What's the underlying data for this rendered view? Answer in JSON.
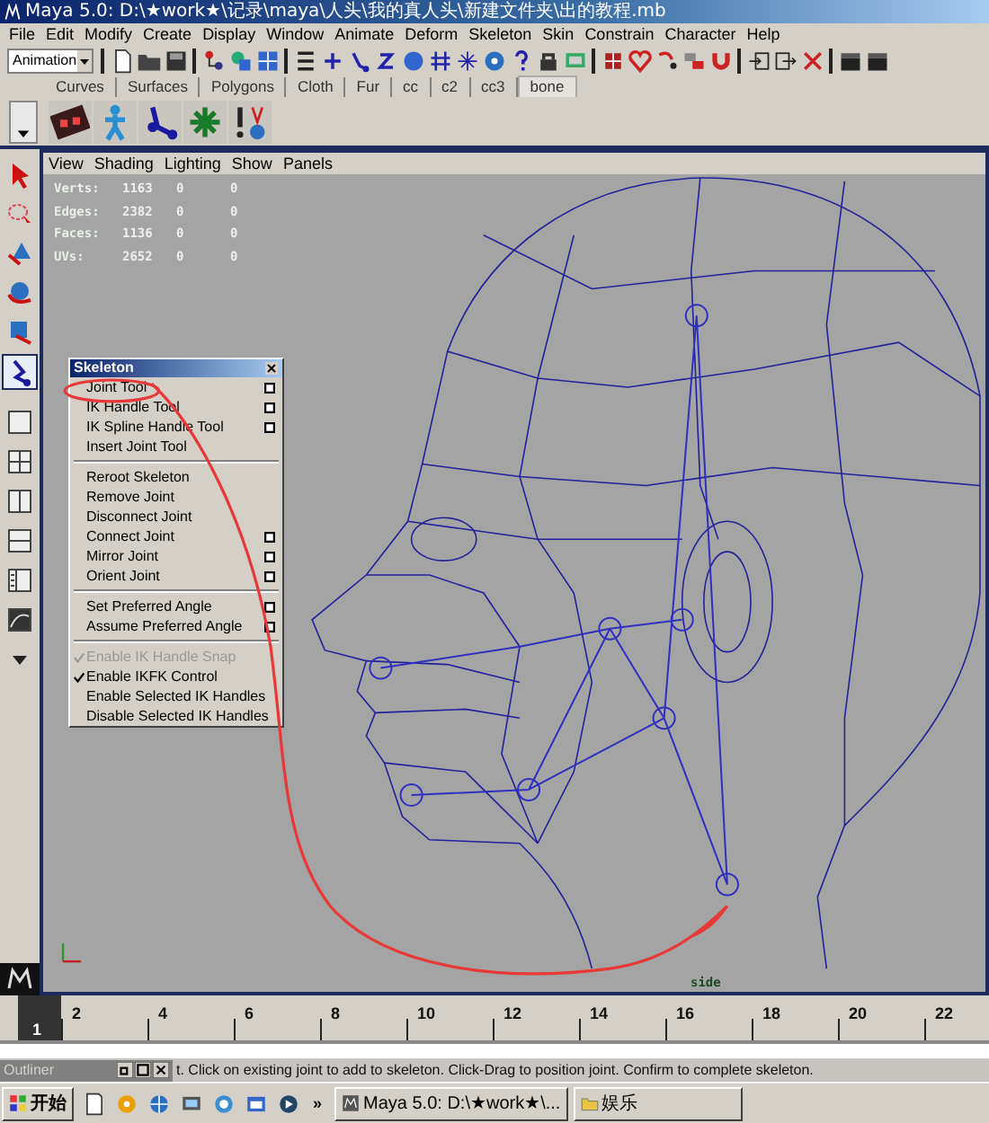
{
  "window": {
    "title": "Maya 5.0: D:\\★work★\\记录\\maya\\人头\\我的真人头\\新建文件夹\\出的教程.mb"
  },
  "menu_bar": [
    "File",
    "Edit",
    "Modify",
    "Create",
    "Display",
    "Window",
    "Animate",
    "Deform",
    "Skeleton",
    "Skin",
    "Constrain",
    "Character",
    "Help"
  ],
  "status_line": {
    "menu_set": "Animation"
  },
  "shelf": {
    "tabs": [
      {
        "label": "Curves",
        "selected": false
      },
      {
        "label": "Surfaces",
        "selected": false
      },
      {
        "label": "Polygons",
        "selected": false
      },
      {
        "label": "Cloth",
        "selected": false
      },
      {
        "label": "Fur",
        "selected": false
      },
      {
        "label": "cc",
        "selected": false
      },
      {
        "label": "c2",
        "selected": false
      },
      {
        "label": "cc3",
        "selected": false
      },
      {
        "label": "bone",
        "selected": true
      }
    ]
  },
  "toolbox": {
    "tools": [
      {
        "kind": "select",
        "selected": false
      },
      {
        "kind": "lasso",
        "selected": false
      },
      {
        "kind": "move",
        "selected": false
      },
      {
        "kind": "rotate",
        "selected": false
      },
      {
        "kind": "scale",
        "selected": false
      },
      {
        "kind": "joint",
        "selected": true
      },
      {
        "kind": "layout-single",
        "selected": false
      },
      {
        "kind": "layout-four",
        "selected": false
      },
      {
        "kind": "layout-two",
        "selected": false
      },
      {
        "kind": "layout-stack",
        "selected": false
      },
      {
        "kind": "layout-outliner",
        "selected": false
      },
      {
        "kind": "layout-graph",
        "selected": false
      },
      {
        "kind": "layout-menu",
        "selected": false
      }
    ]
  },
  "viewport": {
    "menu": [
      "View",
      "Shading",
      "Lighting",
      "Show",
      "Panels"
    ],
    "stats": [
      {
        "label": "Verts:",
        "values": [
          "1163",
          "0",
          "0"
        ]
      },
      {
        "label": "Edges:",
        "values": [
          "2382",
          "0",
          "0"
        ]
      },
      {
        "label": "Faces:",
        "values": [
          "1136",
          "0",
          "0"
        ]
      },
      {
        "label": "UVs:",
        "values": [
          "2652",
          "0",
          "0"
        ]
      }
    ],
    "camera": "side"
  },
  "skeleton_menu": {
    "title": "Skeleton",
    "sections": [
      [
        {
          "label": "Joint Tool",
          "option_box": true,
          "checked": false,
          "disabled": false
        },
        {
          "label": "IK Handle Tool",
          "option_box": true,
          "checked": false,
          "disabled": false
        },
        {
          "label": "IK Spline Handle Tool",
          "option_box": true,
          "checked": false,
          "disabled": false
        },
        {
          "label": "Insert Joint Tool",
          "option_box": false,
          "checked": false,
          "disabled": false
        }
      ],
      [
        {
          "label": "Reroot Skeleton",
          "option_box": false,
          "checked": false,
          "disabled": false
        },
        {
          "label": "Remove Joint",
          "option_box": false,
          "checked": false,
          "disabled": false
        },
        {
          "label": "Disconnect Joint",
          "option_box": false,
          "checked": false,
          "disabled": false
        },
        {
          "label": "Connect Joint",
          "option_box": true,
          "checked": false,
          "disabled": false
        },
        {
          "label": "Mirror Joint",
          "option_box": true,
          "checked": false,
          "disabled": false
        },
        {
          "label": "Orient Joint",
          "option_box": true,
          "checked": false,
          "disabled": false
        }
      ],
      [
        {
          "label": "Set Preferred Angle",
          "option_box": true,
          "checked": false,
          "disabled": false
        },
        {
          "label": "Assume Preferred Angle",
          "option_box": true,
          "checked": false,
          "disabled": false
        }
      ],
      [
        {
          "label": "Enable IK Handle Snap",
          "option_box": false,
          "checked": true,
          "disabled": true
        },
        {
          "label": "Enable IKFK Control",
          "option_box": false,
          "checked": true,
          "disabled": false
        },
        {
          "label": "Enable Selected IK Handles",
          "option_box": false,
          "checked": false,
          "disabled": false
        },
        {
          "label": "Disable Selected IK Handles",
          "option_box": false,
          "checked": false,
          "disabled": false
        }
      ]
    ]
  },
  "time_slider": {
    "frames": [
      {
        "label": "1",
        "current": true
      },
      {
        "label": "2",
        "current": false
      },
      {
        "label": "4",
        "current": false
      },
      {
        "label": "6",
        "current": false
      },
      {
        "label": "8",
        "current": false
      },
      {
        "label": "10",
        "current": false
      },
      {
        "label": "12",
        "current": false
      },
      {
        "label": "14",
        "current": false
      },
      {
        "label": "16",
        "current": false
      },
      {
        "label": "18",
        "current": false
      },
      {
        "label": "20",
        "current": false
      },
      {
        "label": "22",
        "current": false
      }
    ]
  },
  "outliner": {
    "title": "Outliner"
  },
  "help_line": "t. Click on existing joint to add to skeleton. Click-Drag to position joint. Confirm to complete skeleton.",
  "taskbar": {
    "start": "开始",
    "more": "»",
    "tasks": [
      {
        "label": "Maya 5.0: D:\\★work★\\..."
      },
      {
        "label": "娱乐"
      }
    ]
  }
}
